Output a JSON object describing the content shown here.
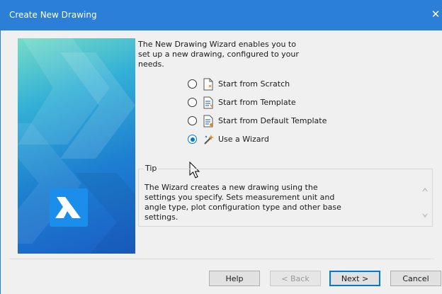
{
  "window": {
    "title": "Create New Drawing",
    "close_glyph": "✕",
    "title_bar_color": "#2b7fd6"
  },
  "intro_text": "The New Drawing Wizard enables you to set up a new drawing, configured to your needs.",
  "options": [
    {
      "label": "Start from Scratch",
      "icon": "blank-page-icon",
      "selected": false
    },
    {
      "label": "Start from Template",
      "icon": "template-page-icon",
      "selected": false
    },
    {
      "label": "Start from Default Template",
      "icon": "default-template-icon",
      "selected": false
    },
    {
      "label": "Use a Wizard",
      "icon": "magic-wand-icon",
      "selected": true
    }
  ],
  "tip": {
    "label": "Tip",
    "text": "The Wizard creates a new drawing using the settings you specify. Sets measurement unit and angle type, plot configuration type and other base settings."
  },
  "buttons": {
    "help": "Help",
    "back": "< Back",
    "next": "Next >",
    "cancel": "Cancel"
  },
  "colors": {
    "accent": "#0078d7",
    "logo_blue": "#1b8dea"
  }
}
